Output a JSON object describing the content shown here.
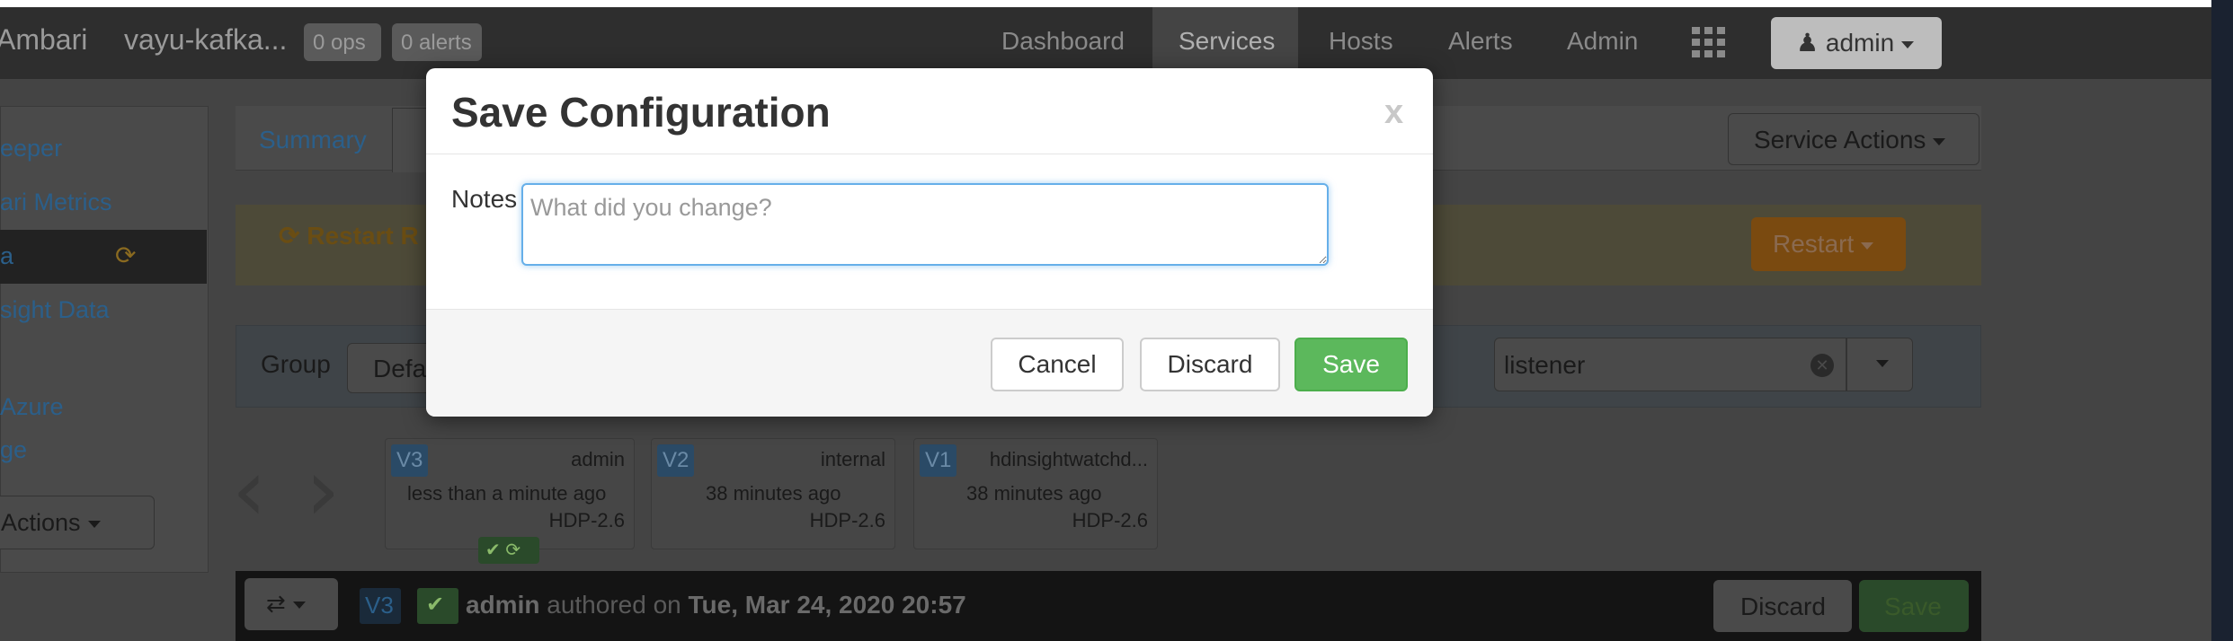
{
  "navbar": {
    "brand": "Ambari",
    "cluster_name": "vayu-kafka...",
    "ops_badge": "0 ops",
    "alerts_badge": "0 alerts",
    "links": [
      "Dashboard",
      "Services",
      "Hosts",
      "Alerts",
      "Admin"
    ],
    "active_link": "Services",
    "user_menu": "admin"
  },
  "sidebar": {
    "items": [
      "eeper",
      "ari Metrics",
      "a",
      "sight Data",
      "Azure",
      "ge"
    ],
    "actions_label": "Actions"
  },
  "main": {
    "tab_summary": "Summary",
    "service_actions": "Service Actions",
    "restart_banner": "Restart R",
    "restart_button": "Restart",
    "group_label": "Group",
    "group_value": "Defa",
    "search_value": "listener"
  },
  "versions": [
    {
      "badge": "V3",
      "author": "admin",
      "time": "less than a minute ago",
      "stack": "HDP-2.6"
    },
    {
      "badge": "V2",
      "author": "internal",
      "time": "38 minutes ago",
      "stack": "HDP-2.6"
    },
    {
      "badge": "V1",
      "author": "hdinsightwatchd...",
      "time": "38 minutes ago",
      "stack": "HDP-2.6"
    }
  ],
  "bottom_bar": {
    "version_badge": "V3",
    "author": "admin",
    "authored_text": "authored on",
    "date": "Tue, Mar 24, 2020 20:57",
    "discard": "Discard",
    "save": "Save"
  },
  "modal": {
    "title": "Save Configuration",
    "close": "x",
    "notes_label": "Notes",
    "notes_placeholder": "What did you change?",
    "notes_value": "",
    "cancel": "Cancel",
    "discard": "Discard",
    "save": "Save"
  }
}
